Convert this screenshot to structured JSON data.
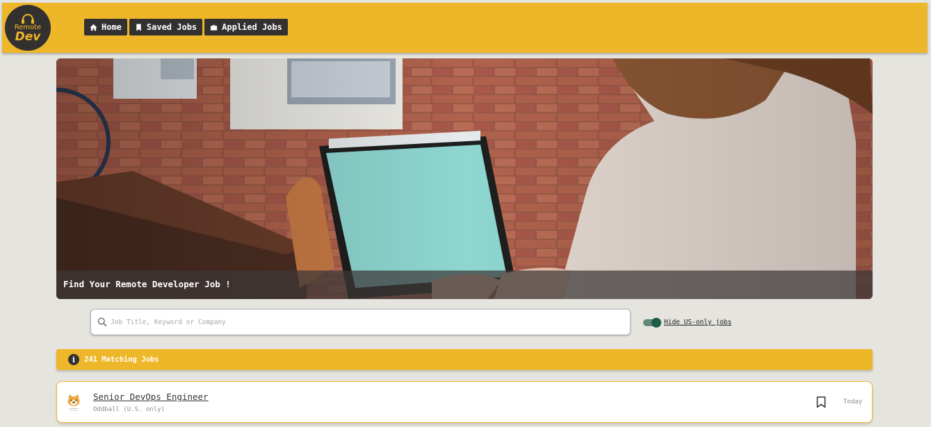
{
  "header": {
    "logo": {
      "line1": "Remote",
      "line2": "Dev"
    },
    "nav": [
      {
        "label": "Home",
        "icon": "home-icon"
      },
      {
        "label": "Saved Jobs",
        "icon": "bookmark-icon"
      },
      {
        "label": "Applied Jobs",
        "icon": "briefcase-icon"
      }
    ]
  },
  "hero": {
    "caption": "Find Your Remote Developer Job !",
    "image": "person-working-on-laptop-against-brick-wall"
  },
  "search": {
    "placeholder": "Job Title, Keyword or Company",
    "value": "",
    "icon": "search-icon"
  },
  "filter": {
    "label": "Hide US-only jobs",
    "enabled": true
  },
  "results": {
    "count_text": "241 Matching Jobs",
    "icon": "info-icon"
  },
  "jobs": [
    {
      "title": "Senior DevOps Engineer",
      "company": "Oddball (U.S. only)",
      "date": "Today",
      "logo": "dog-logo-icon"
    }
  ],
  "colors": {
    "accent": "#eeb72a",
    "dark": "#333030",
    "background": "#e5e4df",
    "toggle": "#1f5b49"
  }
}
